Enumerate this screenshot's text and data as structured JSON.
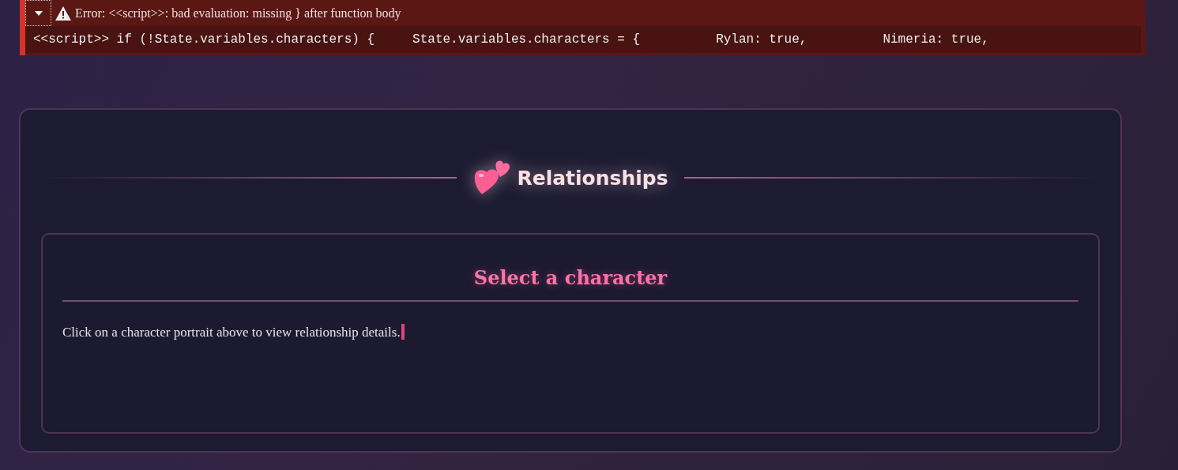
{
  "error": {
    "expanded": true,
    "message": "Error: <<script>>: bad evaluation: missing } after function body",
    "source": "<<script>> if (!State.variables.characters) {     State.variables.characters = {          Rylan: true,          Nimeria: true,"
  },
  "panel": {
    "title": "Relationships",
    "detail": {
      "heading": "Select a character",
      "text": "Click on a character portrait above to view relationship details."
    }
  }
}
